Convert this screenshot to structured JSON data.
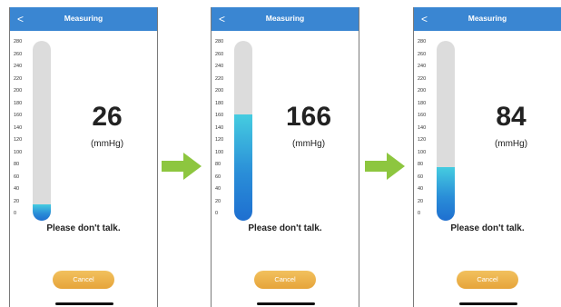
{
  "screens": [
    {
      "title": "Measuring",
      "back": "<",
      "value": "26",
      "unit": "(mmHg)",
      "level": 26,
      "message": "Please don't talk.",
      "cancel": "Cancel"
    },
    {
      "title": "Measuring",
      "back": "<",
      "value": "166",
      "unit": "(mmHg)",
      "level": 166,
      "message": "Please don't talk.",
      "cancel": "Cancel"
    },
    {
      "title": "Measuring",
      "back": "<",
      "value": "84",
      "unit": "(mmHg)",
      "level": 84,
      "message": "Please don't talk.",
      "cancel": "Cancel"
    }
  ],
  "scale": {
    "min": 0,
    "max": 280,
    "ticks": [
      "280",
      "260",
      "240",
      "220",
      "200",
      "180",
      "160",
      "140",
      "120",
      "100",
      "80",
      "60",
      "40",
      "20",
      "0"
    ]
  },
  "colors": {
    "header": "#3a86d2",
    "arrow": "#8dc63f",
    "fill_top": "#45cce0",
    "fill_bottom": "#1e6fd0",
    "cancel": "#e6a43a"
  }
}
